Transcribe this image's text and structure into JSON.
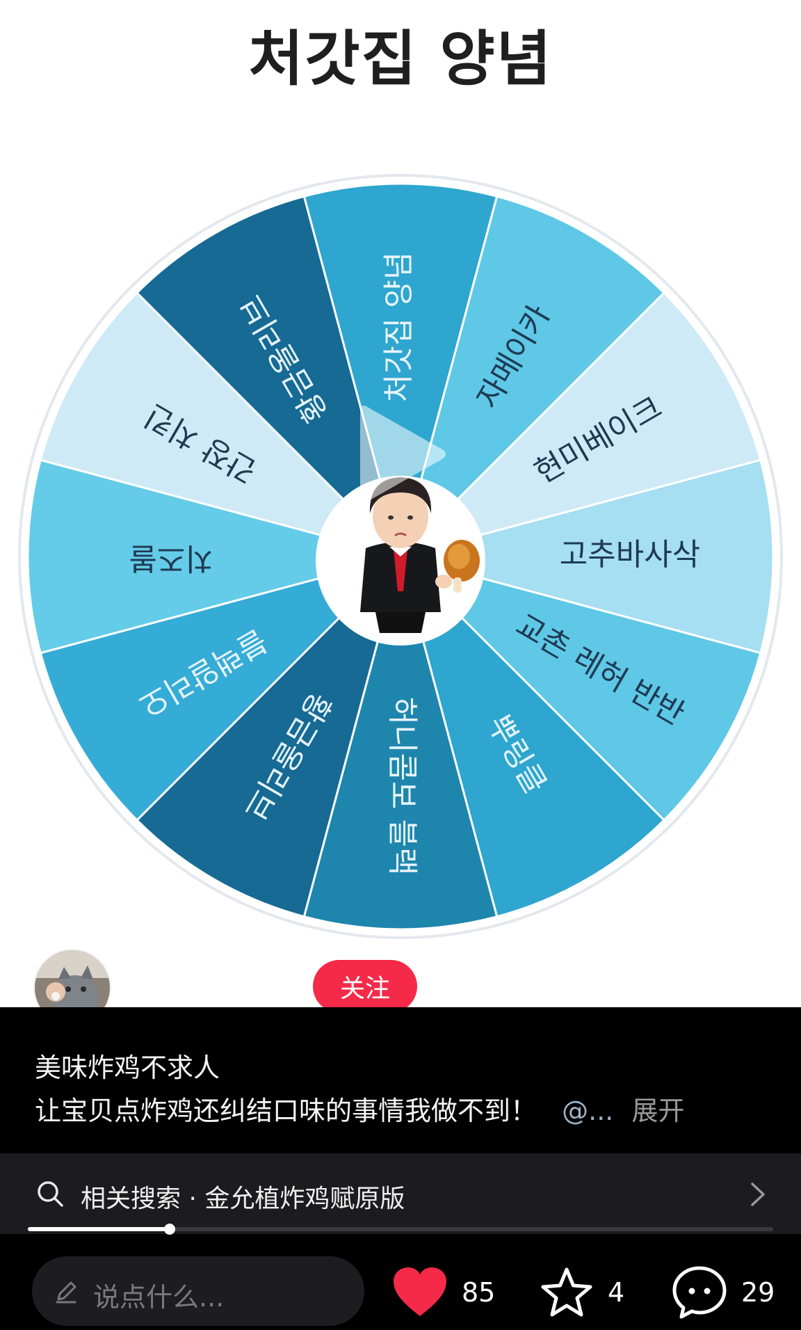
{
  "video": {
    "title": "처갓집 양념",
    "wheel_segments": [
      {
        "label": "처갓집 양념",
        "color": "#2ea6cf"
      },
      {
        "label": "자메이카",
        "color": "#5ec8e6"
      },
      {
        "label": "현미베이크",
        "color": "#cfeaf7"
      },
      {
        "label": "고추바사삭",
        "color": "#a6def2"
      },
      {
        "label": "교촌 레허 반반",
        "color": "#5ec8e6"
      },
      {
        "label": "뿌링클",
        "color": "#2ea6cf"
      },
      {
        "label": "허니콤보 블랙",
        "color": "#1e86ad"
      },
      {
        "label": "황금올리브",
        "color": "#166a94"
      },
      {
        "label": "블랙알리오",
        "color": "#35acd6"
      },
      {
        "label": "치즈볼",
        "color": "#64cbe8"
      },
      {
        "label": "간장 치킨",
        "color": "#cfeaf7"
      },
      {
        "label": "황금올리브",
        "color": "#166a94"
      }
    ],
    "center_icon": "man-holding-fried-chicken-sticker",
    "play_icon": "play-icon"
  },
  "author": {
    "avatar_icon": "cat-avatar",
    "follow_label": "关注"
  },
  "post": {
    "title": "美味炸鸡不求人",
    "description": "让宝贝点炸鸡还纠结口味的事情我做不到！",
    "mention": "@...",
    "expand_label": "展开"
  },
  "related_search": {
    "text": "相关搜索 · 金允植炸鸡赋原版",
    "icon": "search-icon"
  },
  "progress": {
    "fraction": 0.19
  },
  "bottom_bar": {
    "comment_placeholder": "说点什么...",
    "likes": "85",
    "favorites": "4",
    "comments": "29"
  },
  "colors": {
    "like": "#f42a48",
    "follow": "#f42a48",
    "panel_bg": "#000000"
  }
}
